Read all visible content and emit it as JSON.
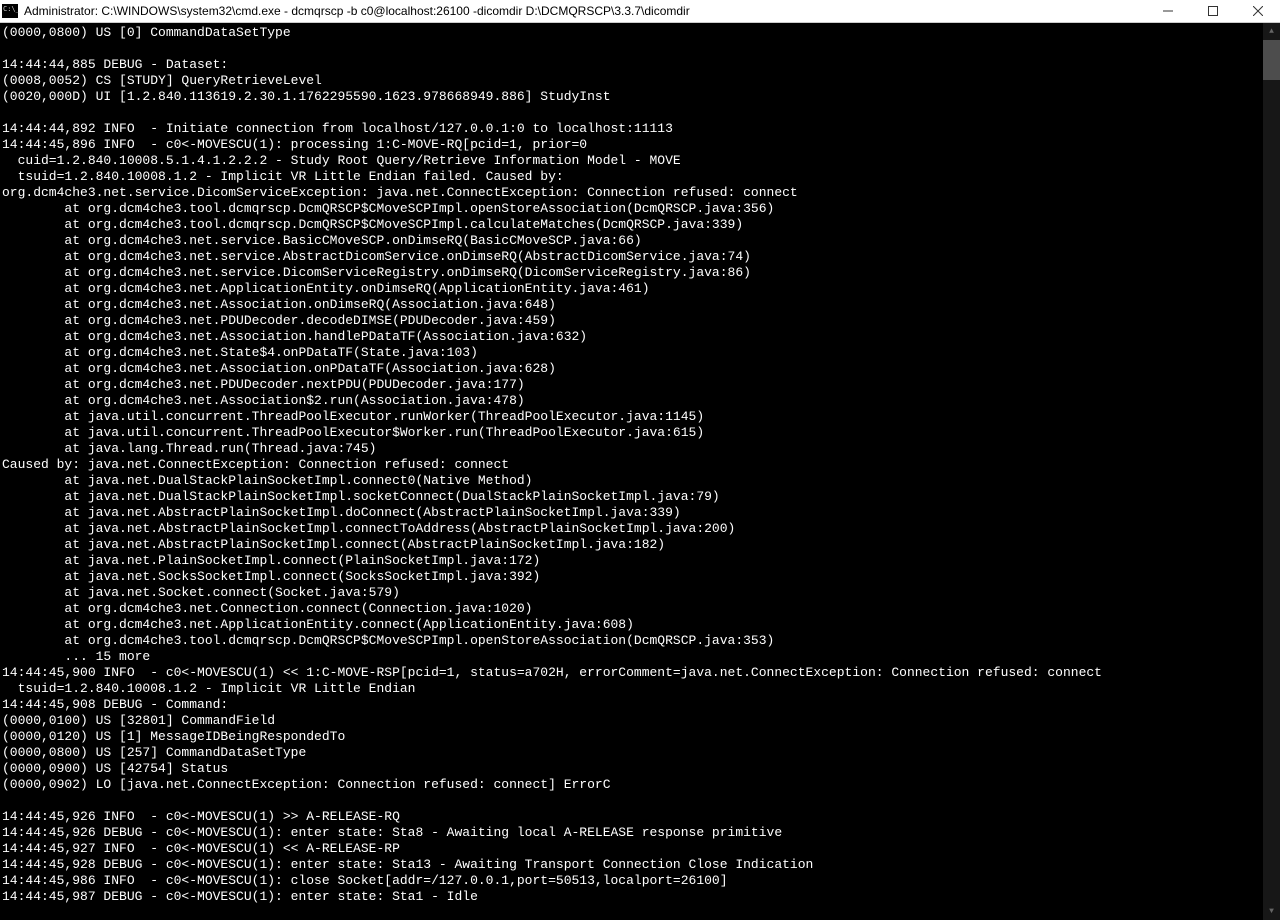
{
  "window": {
    "title": "Administrator: C:\\WINDOWS\\system32\\cmd.exe - dcmqrscp  -b c0@localhost:26100 -dicomdir D:\\DCMQRSCP\\3.3.7\\dicomdir"
  },
  "console": {
    "lines": [
      "(0000,0800) US [0] CommandDataSetType",
      "",
      "14:44:44,885 DEBUG - Dataset:",
      "(0008,0052) CS [STUDY] QueryRetrieveLevel",
      "(0020,000D) UI [1.2.840.113619.2.30.1.1762295590.1623.978668949.886] StudyInst",
      "",
      "14:44:44,892 INFO  - Initiate connection from localhost/127.0.0.1:0 to localhost:11113",
      "14:44:45,896 INFO  - c0<-MOVESCU(1): processing 1:C-MOVE-RQ[pcid=1, prior=0",
      "  cuid=1.2.840.10008.5.1.4.1.2.2.2 - Study Root Query/Retrieve Information Model - MOVE",
      "  tsuid=1.2.840.10008.1.2 - Implicit VR Little Endian failed. Caused by:",
      "org.dcm4che3.net.service.DicomServiceException: java.net.ConnectException: Connection refused: connect",
      "        at org.dcm4che3.tool.dcmqrscp.DcmQRSCP$CMoveSCPImpl.openStoreAssociation(DcmQRSCP.java:356)",
      "        at org.dcm4che3.tool.dcmqrscp.DcmQRSCP$CMoveSCPImpl.calculateMatches(DcmQRSCP.java:339)",
      "        at org.dcm4che3.net.service.BasicCMoveSCP.onDimseRQ(BasicCMoveSCP.java:66)",
      "        at org.dcm4che3.net.service.AbstractDicomService.onDimseRQ(AbstractDicomService.java:74)",
      "        at org.dcm4che3.net.service.DicomServiceRegistry.onDimseRQ(DicomServiceRegistry.java:86)",
      "        at org.dcm4che3.net.ApplicationEntity.onDimseRQ(ApplicationEntity.java:461)",
      "        at org.dcm4che3.net.Association.onDimseRQ(Association.java:648)",
      "        at org.dcm4che3.net.PDUDecoder.decodeDIMSE(PDUDecoder.java:459)",
      "        at org.dcm4che3.net.Association.handlePDataTF(Association.java:632)",
      "        at org.dcm4che3.net.State$4.onPDataTF(State.java:103)",
      "        at org.dcm4che3.net.Association.onPDataTF(Association.java:628)",
      "        at org.dcm4che3.net.PDUDecoder.nextPDU(PDUDecoder.java:177)",
      "        at org.dcm4che3.net.Association$2.run(Association.java:478)",
      "        at java.util.concurrent.ThreadPoolExecutor.runWorker(ThreadPoolExecutor.java:1145)",
      "        at java.util.concurrent.ThreadPoolExecutor$Worker.run(ThreadPoolExecutor.java:615)",
      "        at java.lang.Thread.run(Thread.java:745)",
      "Caused by: java.net.ConnectException: Connection refused: connect",
      "        at java.net.DualStackPlainSocketImpl.connect0(Native Method)",
      "        at java.net.DualStackPlainSocketImpl.socketConnect(DualStackPlainSocketImpl.java:79)",
      "        at java.net.AbstractPlainSocketImpl.doConnect(AbstractPlainSocketImpl.java:339)",
      "        at java.net.AbstractPlainSocketImpl.connectToAddress(AbstractPlainSocketImpl.java:200)",
      "        at java.net.AbstractPlainSocketImpl.connect(AbstractPlainSocketImpl.java:182)",
      "        at java.net.PlainSocketImpl.connect(PlainSocketImpl.java:172)",
      "        at java.net.SocksSocketImpl.connect(SocksSocketImpl.java:392)",
      "        at java.net.Socket.connect(Socket.java:579)",
      "        at org.dcm4che3.net.Connection.connect(Connection.java:1020)",
      "        at org.dcm4che3.net.ApplicationEntity.connect(ApplicationEntity.java:608)",
      "        at org.dcm4che3.tool.dcmqrscp.DcmQRSCP$CMoveSCPImpl.openStoreAssociation(DcmQRSCP.java:353)",
      "        ... 15 more",
      "14:44:45,900 INFO  - c0<-MOVESCU(1) << 1:C-MOVE-RSP[pcid=1, status=a702H, errorComment=java.net.ConnectException: Connection refused: connect",
      "  tsuid=1.2.840.10008.1.2 - Implicit VR Little Endian",
      "14:44:45,908 DEBUG - Command:",
      "(0000,0100) US [32801] CommandField",
      "(0000,0120) US [1] MessageIDBeingRespondedTo",
      "(0000,0800) US [257] CommandDataSetType",
      "(0000,0900) US [42754] Status",
      "(0000,0902) LO [java.net.ConnectException: Connection refused: connect] ErrorC",
      "",
      "14:44:45,926 INFO  - c0<-MOVESCU(1) >> A-RELEASE-RQ",
      "14:44:45,926 DEBUG - c0<-MOVESCU(1): enter state: Sta8 - Awaiting local A-RELEASE response primitive",
      "14:44:45,927 INFO  - c0<-MOVESCU(1) << A-RELEASE-RP",
      "14:44:45,928 DEBUG - c0<-MOVESCU(1): enter state: Sta13 - Awaiting Transport Connection Close Indication",
      "14:44:45,986 INFO  - c0<-MOVESCU(1): close Socket[addr=/127.0.0.1,port=50513,localport=26100]",
      "14:44:45,987 DEBUG - c0<-MOVESCU(1): enter state: Sta1 - Idle"
    ]
  }
}
